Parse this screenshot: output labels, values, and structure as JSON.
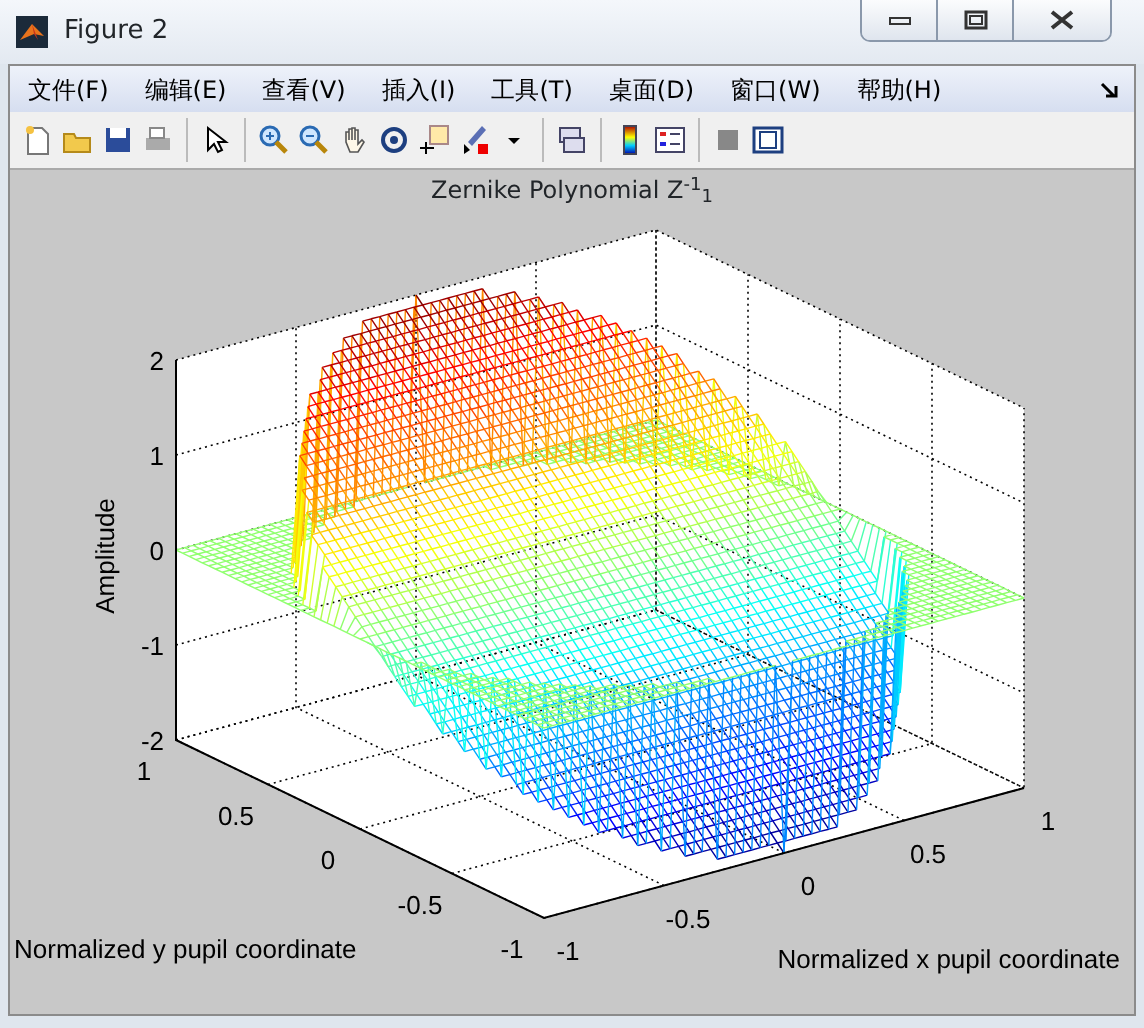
{
  "window": {
    "title": "Figure 2"
  },
  "menu": [
    "文件(F)",
    "编辑(E)",
    "查看(V)",
    "插入(I)",
    "工具(T)",
    "桌面(D)",
    "窗口(W)",
    "帮助(H)"
  ],
  "plot": {
    "title": "Zernike Polynomial  Z$^{-1}$$_{1}$",
    "zlabel": "Amplitude",
    "ylabel": "Normalized y pupil coordinate",
    "xlabel": "Normalized x pupil coordinate",
    "z_ticks": [
      "2",
      "1",
      "0",
      "-1",
      "-2"
    ],
    "y_ticks": [
      "1",
      "0.5",
      "0",
      "-0.5",
      "-1"
    ],
    "x_ticks": [
      "-1",
      "-0.5",
      "0",
      "0.5",
      "1"
    ]
  }
}
